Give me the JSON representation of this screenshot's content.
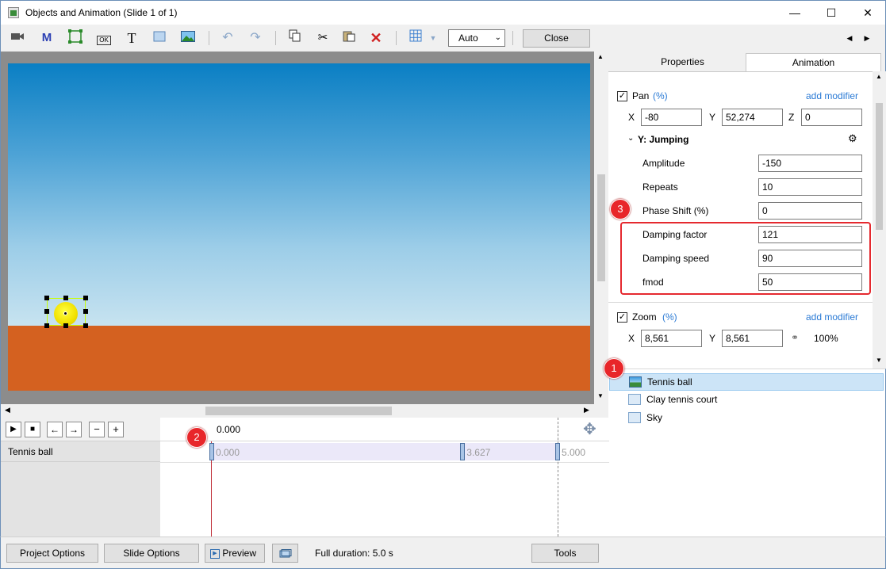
{
  "window": {
    "title": "Objects and Animation (Slide 1 of 1)",
    "min_glyph": "—",
    "max_glyph": "☐",
    "close_glyph": "✕"
  },
  "toolbar": {
    "mask_label": "M",
    "ok_label": "OK",
    "text_label": "T",
    "zoom_select": "Auto",
    "close_label": "Close",
    "nav_prev": "◀",
    "nav_next": "▶"
  },
  "tabs": {
    "properties": "Properties",
    "animation": "Animation"
  },
  "pan": {
    "label": "Pan",
    "unit": "(%)",
    "checked": true,
    "add_modifier": "add modifier",
    "x_label": "X",
    "x_value": "-80",
    "y_label": "Y",
    "y_value": "52,274",
    "z_label": "Z",
    "z_value": "0"
  },
  "modifier": {
    "title": "Y: Jumping",
    "rows": [
      {
        "label": "Amplitude",
        "value": "-150"
      },
      {
        "label": "Repeats",
        "value": "10"
      },
      {
        "label": "Phase Shift (%)",
        "value": "0"
      },
      {
        "label": "Damping factor",
        "value": "121"
      },
      {
        "label": "Damping speed",
        "value": "90"
      },
      {
        "label": "fmod",
        "value": "50"
      }
    ]
  },
  "zoom": {
    "label": "Zoom",
    "unit": "(%)",
    "checked": true,
    "add_modifier": "add modifier",
    "x_label": "X",
    "x_value": "8,561",
    "y_label": "Y",
    "y_value": "8,561",
    "percent": "100%"
  },
  "badges": {
    "one": "1",
    "two": "2",
    "three": "3"
  },
  "objects": [
    {
      "name": "Tennis ball",
      "selected": true
    },
    {
      "name": "Clay tennis court",
      "selected": false
    },
    {
      "name": "Sky",
      "selected": false
    }
  ],
  "timeline": {
    "current_time": "0.000",
    "row_label": "Tennis ball",
    "keyframes": [
      {
        "label": "0.000",
        "t": 0.0
      },
      {
        "label": "3.627",
        "t": 3.627
      },
      {
        "label": "5.000",
        "t": 5.0
      }
    ]
  },
  "bottom": {
    "project_options": "Project Options",
    "slide_options": "Slide Options",
    "preview": "Preview",
    "full_duration": "Full duration: 5.0 s",
    "tools": "Tools"
  },
  "colors": {
    "accent_red": "#e8262a",
    "link_blue": "#2a7ad5",
    "selection": "#cce4f7",
    "court": "#d46120"
  }
}
